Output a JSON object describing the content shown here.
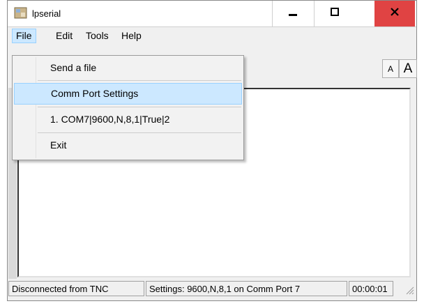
{
  "window": {
    "title": "lpserial",
    "icons": {
      "app": "app-icon",
      "minimize": "minimize-icon",
      "maximize": "maximize-icon",
      "close": "close-icon"
    },
    "close_color": "#e04343"
  },
  "menubar": {
    "items": [
      "File",
      "Edit",
      "Tools",
      "Help"
    ]
  },
  "file_menu": {
    "send_file": "Send a file",
    "comm_port_settings": "Comm Port Settings",
    "recent_port": "1. COM7|9600,N,8,1|True|2",
    "exit": "Exit"
  },
  "toolbar": {
    "font_smaller": "A",
    "font_larger": "A"
  },
  "statusbar": {
    "connection": "Disconnected from TNC",
    "settings": "Settings: 9600,N,8,1 on Comm Port 7",
    "timer": "00:00:01"
  }
}
